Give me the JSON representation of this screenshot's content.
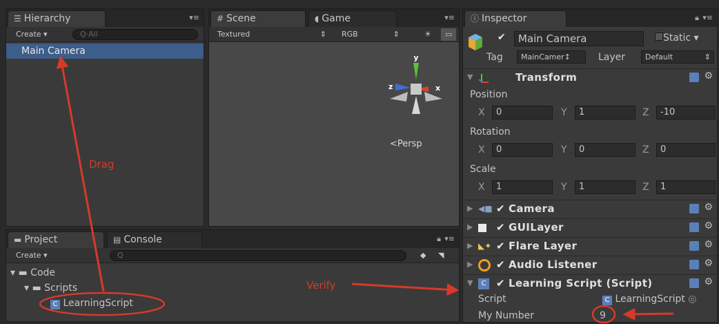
{
  "hierarchy": {
    "tab_label": "Hierarchy",
    "create_label": "Create",
    "search_placeholder": "Q·All",
    "items": [
      {
        "label": "Main Camera"
      }
    ]
  },
  "scene": {
    "tab_label": "Scene",
    "game_tab_label": "Game",
    "shading_mode": "Textured",
    "color_mode": "RGB",
    "gizmo": {
      "y": "y",
      "x": "x",
      "z": "z",
      "view": "Persp"
    }
  },
  "project": {
    "tab_label": "Project",
    "console_tab_label": "Console",
    "create_label": "Create",
    "tree": [
      {
        "label": "Code"
      },
      {
        "label": "Scripts"
      },
      {
        "label": "LearningScript"
      }
    ]
  },
  "inspector": {
    "tab_label": "Inspector",
    "object_name": "Main Camera",
    "static_label": "Static",
    "tag_label": "Tag",
    "tag_value": "MainCamer↕",
    "layer_label": "Layer",
    "layer_value": "Default",
    "transform": {
      "title": "Transform",
      "position_label": "Position",
      "rotation_label": "Rotation",
      "scale_label": "Scale",
      "axis_x": "X",
      "axis_y": "Y",
      "axis_z": "Z",
      "position": {
        "x": "0",
        "y": "1",
        "z": "-10"
      },
      "rotation": {
        "x": "0",
        "y": "0",
        "z": "0"
      },
      "scale": {
        "x": "1",
        "y": "1",
        "z": "1"
      }
    },
    "components": [
      {
        "name": "Camera"
      },
      {
        "name": "GUILayer"
      },
      {
        "name": "Flare Layer"
      },
      {
        "name": "Audio Listener"
      },
      {
        "name": "Learning Script (Script)"
      }
    ],
    "script_label": "Script",
    "script_value": "LearningScript",
    "my_number_label": "My Number",
    "my_number_value": "9"
  },
  "annotations": {
    "drag": "Drag",
    "verify": "Verify",
    "color": "#d63a2a"
  }
}
